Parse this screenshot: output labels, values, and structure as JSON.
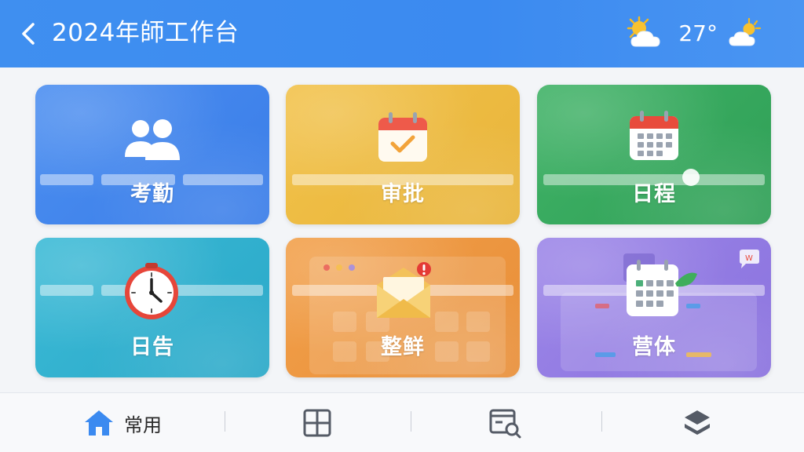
{
  "header": {
    "title": "2024年師工作台",
    "back_icon": "chevron-left-icon",
    "temperature": "27°",
    "weather_icon_left": "partly-sunny-icon",
    "weather_icon_right": "partly-sunny-icon"
  },
  "tiles": [
    {
      "label": "考勤",
      "icon": "people-icon",
      "color": "#4b8ef0"
    },
    {
      "label": "审批",
      "icon": "calendar-check-icon",
      "color": "#f2c24a"
    },
    {
      "label": "日程",
      "icon": "calendar-grid-icon",
      "color": "#3fb266"
    },
    {
      "label": "日告",
      "icon": "clock-icon",
      "color": "#3bbad6"
    },
    {
      "label": "整鲜",
      "icon": "envelope-alert-icon",
      "color": "#f2a04a"
    },
    {
      "label": "营体",
      "icon": "calendar-leaf-icon",
      "color": "#9c86e8"
    }
  ],
  "tabbar": {
    "tabs": [
      {
        "label": "常用",
        "icon": "home-icon",
        "active": true
      },
      {
        "label": "",
        "icon": "grid-icon",
        "active": false
      },
      {
        "label": "",
        "icon": "search-document-icon",
        "active": false
      },
      {
        "label": "",
        "icon": "layers-icon",
        "active": false
      }
    ],
    "active_color": "#3b8af0",
    "inactive_color": "#555b66"
  }
}
